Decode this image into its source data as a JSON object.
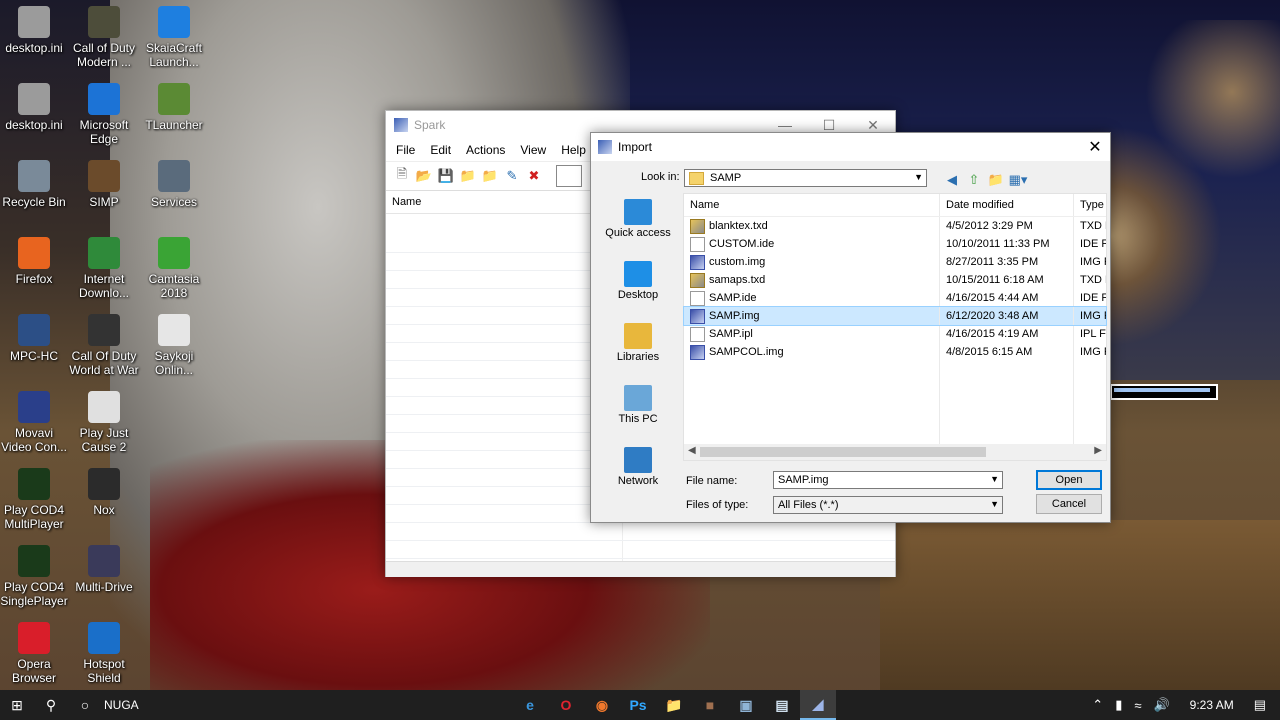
{
  "desktop_icons": [
    {
      "label": "desktop.ini",
      "icon": "settings-file-icon",
      "color": "#9b9b9b"
    },
    {
      "label": "Call of Duty Modern ...",
      "icon": "cod-mw-icon",
      "color": "#4d4d3a"
    },
    {
      "label": "SkaiaCraft Launch...",
      "icon": "skaiacraft-icon",
      "color": "#1e7fe0"
    },
    {
      "label": "desktop.ini",
      "icon": "settings-file-icon",
      "color": "#9b9b9b"
    },
    {
      "label": "Microsoft Edge",
      "icon": "edge-icon",
      "color": "#1c73d6"
    },
    {
      "label": "TLauncher",
      "icon": "tlauncher-icon",
      "color": "#5b8a34"
    },
    {
      "label": "Recycle Bin",
      "icon": "recycle-bin-icon",
      "color": "#7a8a99"
    },
    {
      "label": "SIMP",
      "icon": "simp-icon",
      "color": "#6b4b2b"
    },
    {
      "label": "Services",
      "icon": "gear-icon",
      "color": "#5a6b7c"
    },
    {
      "label": "Firefox",
      "icon": "firefox-icon",
      "color": "#e8641f"
    },
    {
      "label": "Internet Downlo...",
      "icon": "idm-icon",
      "color": "#2f8a3a"
    },
    {
      "label": "Camtasia 2018",
      "icon": "camtasia-icon",
      "color": "#3aa435"
    },
    {
      "label": "MPC-HC",
      "icon": "mpc-hc-icon",
      "color": "#2c4f86"
    },
    {
      "label": "Call Of Duty World at War",
      "icon": "cod-waw-icon",
      "color": "#333333"
    },
    {
      "label": "Saykoji Onlin...",
      "icon": "text-file-icon",
      "color": "#e6e6e6"
    },
    {
      "label": "Movavi Video Con...",
      "icon": "movavi-icon",
      "color": "#2a3f8a"
    },
    {
      "label": "Play Just Cause 2",
      "icon": "just-cause-icon",
      "color": "#e0e0e0"
    },
    {
      "label": "Play COD4 MultiPlayer",
      "icon": "cod4-icon",
      "color": "#1a3a1a"
    },
    {
      "label": "Nox",
      "icon": "nox-icon",
      "color": "#2b2b2b"
    },
    {
      "label": "Play COD4 SinglePlayer",
      "icon": "cod4-icon",
      "color": "#1a3a1a"
    },
    {
      "label": "Multi-Drive",
      "icon": "nox-multi-icon",
      "color": "#3a3a5a"
    },
    {
      "label": "Opera Browser",
      "icon": "opera-icon",
      "color": "#d91e2a"
    },
    {
      "label": "Hotspot Shield",
      "icon": "hotspot-shield-icon",
      "color": "#1a6fc9"
    }
  ],
  "spark": {
    "title": "Spark",
    "menu": [
      "File",
      "Edit",
      "Actions",
      "View",
      "Help"
    ],
    "list_header": "Name"
  },
  "import": {
    "title": "Import",
    "look_in_label": "Look in:",
    "look_in_value": "SAMP",
    "places": [
      {
        "label": "Quick access",
        "icon": "star-icon",
        "color": "#2b8ad8"
      },
      {
        "label": "Desktop",
        "icon": "desktop-icon",
        "color": "#1e8fe6"
      },
      {
        "label": "Libraries",
        "icon": "libraries-icon",
        "color": "#e8b73c"
      },
      {
        "label": "This PC",
        "icon": "computer-icon",
        "color": "#6aa7d8"
      },
      {
        "label": "Network",
        "icon": "network-icon",
        "color": "#2f7cc4"
      }
    ],
    "columns": [
      "Name",
      "Date modified",
      "Type"
    ],
    "files": [
      {
        "name": "blanktex.txd",
        "date": "4/5/2012 3:29 PM",
        "type": "TXD F",
        "kind": "txd"
      },
      {
        "name": "CUSTOM.ide",
        "date": "10/10/2011 11:33 PM",
        "type": "IDE Fi",
        "kind": "doc"
      },
      {
        "name": "custom.img",
        "date": "8/27/2011 3:35 PM",
        "type": "IMG F",
        "kind": "img"
      },
      {
        "name": "samaps.txd",
        "date": "10/15/2011 6:18 AM",
        "type": "TXD F",
        "kind": "txd"
      },
      {
        "name": "SAMP.ide",
        "date": "4/16/2015 4:44 AM",
        "type": "IDE Fi",
        "kind": "doc"
      },
      {
        "name": "SAMP.img",
        "date": "6/12/2020 3:48 AM",
        "type": "IMG F",
        "kind": "img",
        "selected": true
      },
      {
        "name": "SAMP.ipl",
        "date": "4/16/2015 4:19 AM",
        "type": "IPL Fi",
        "kind": "doc"
      },
      {
        "name": "SAMPCOL.img",
        "date": "4/8/2015 6:15 AM",
        "type": "IMG F",
        "kind": "img"
      }
    ],
    "file_name_label": "File name:",
    "file_name_value": "SAMP.img",
    "file_type_label": "Files of type:",
    "file_type_value": "All Files (*.*)",
    "open_label": "Open",
    "cancel_label": "Cancel"
  },
  "taskbar": {
    "search_text": "NUGA",
    "apps": [
      "edge-icon",
      "opera-icon",
      "firefox-icon",
      "photoshop-icon",
      "file-explorer-icon",
      "simp-icon",
      "monitor-icon",
      "notepad-icon",
      "spark-icon"
    ],
    "clock": "9:23 AM"
  },
  "colors": {
    "accent": "#0078d7",
    "selection": "#cce8ff",
    "taskbar": "#1f1f1f"
  }
}
